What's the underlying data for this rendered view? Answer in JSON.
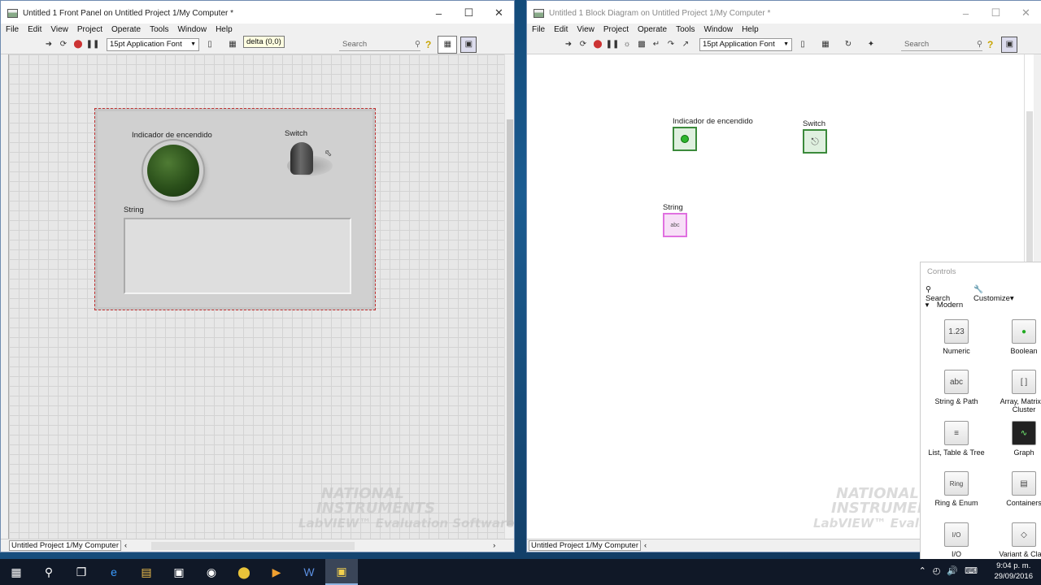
{
  "front_panel": {
    "title": "Untitled 1 Front Panel on Untitled Project 1/My Computer *",
    "menu": [
      "File",
      "Edit",
      "View",
      "Project",
      "Operate",
      "Tools",
      "Window",
      "Help"
    ],
    "font_select": "15pt Application Font",
    "search_placeholder": "Search",
    "tooltip": "delta (0,0)",
    "controls": {
      "led_label": "Indicador de encendido",
      "switch_label": "Switch",
      "string_label": "String"
    },
    "status_path": "Untitled Project 1/My Computer"
  },
  "block_diagram": {
    "title": "Untitled 1 Block Diagram on Untitled Project 1/My Computer *",
    "menu": [
      "File",
      "Edit",
      "View",
      "Project",
      "Operate",
      "Tools",
      "Window",
      "Help"
    ],
    "font_select": "15pt Application Font",
    "search_placeholder": "Search",
    "terminals": {
      "led_label": "Indicador de encendido",
      "switch_label": "Switch",
      "string_label": "String",
      "string_glyph": "abc"
    },
    "status_path": "Untitled Project 1/My Computer"
  },
  "watermark": {
    "line1": "NATIONAL",
    "line2": "INSTRUMENTS",
    "line3": "LabVIEW™ Evaluation Software",
    "line3_short": "LabVIEW™ Evalu"
  },
  "controls_palette": {
    "title": "Controls",
    "search": "Search",
    "customize": "Customize▾",
    "category": "Modern",
    "items": [
      {
        "label": "Numeric",
        "glyph": "1.23"
      },
      {
        "label": "Boolean",
        "glyph": "●"
      },
      {
        "label": "String & Path",
        "glyph": "abc"
      },
      {
        "label": "Array, Matrix & Cluster",
        "glyph": "[ ]"
      },
      {
        "label": "List, Table & Tree",
        "glyph": "≡"
      },
      {
        "label": "Graph",
        "glyph": "∿"
      },
      {
        "label": "Ring & Enum",
        "glyph": "Ring"
      },
      {
        "label": "Containers",
        "glyph": "▤"
      },
      {
        "label": "I/O",
        "glyph": "I/O"
      },
      {
        "label": "Variant & Class",
        "glyph": "◇"
      }
    ]
  },
  "taskbar": {
    "time": "9:04 p. m.",
    "date": "29/09/2016"
  }
}
